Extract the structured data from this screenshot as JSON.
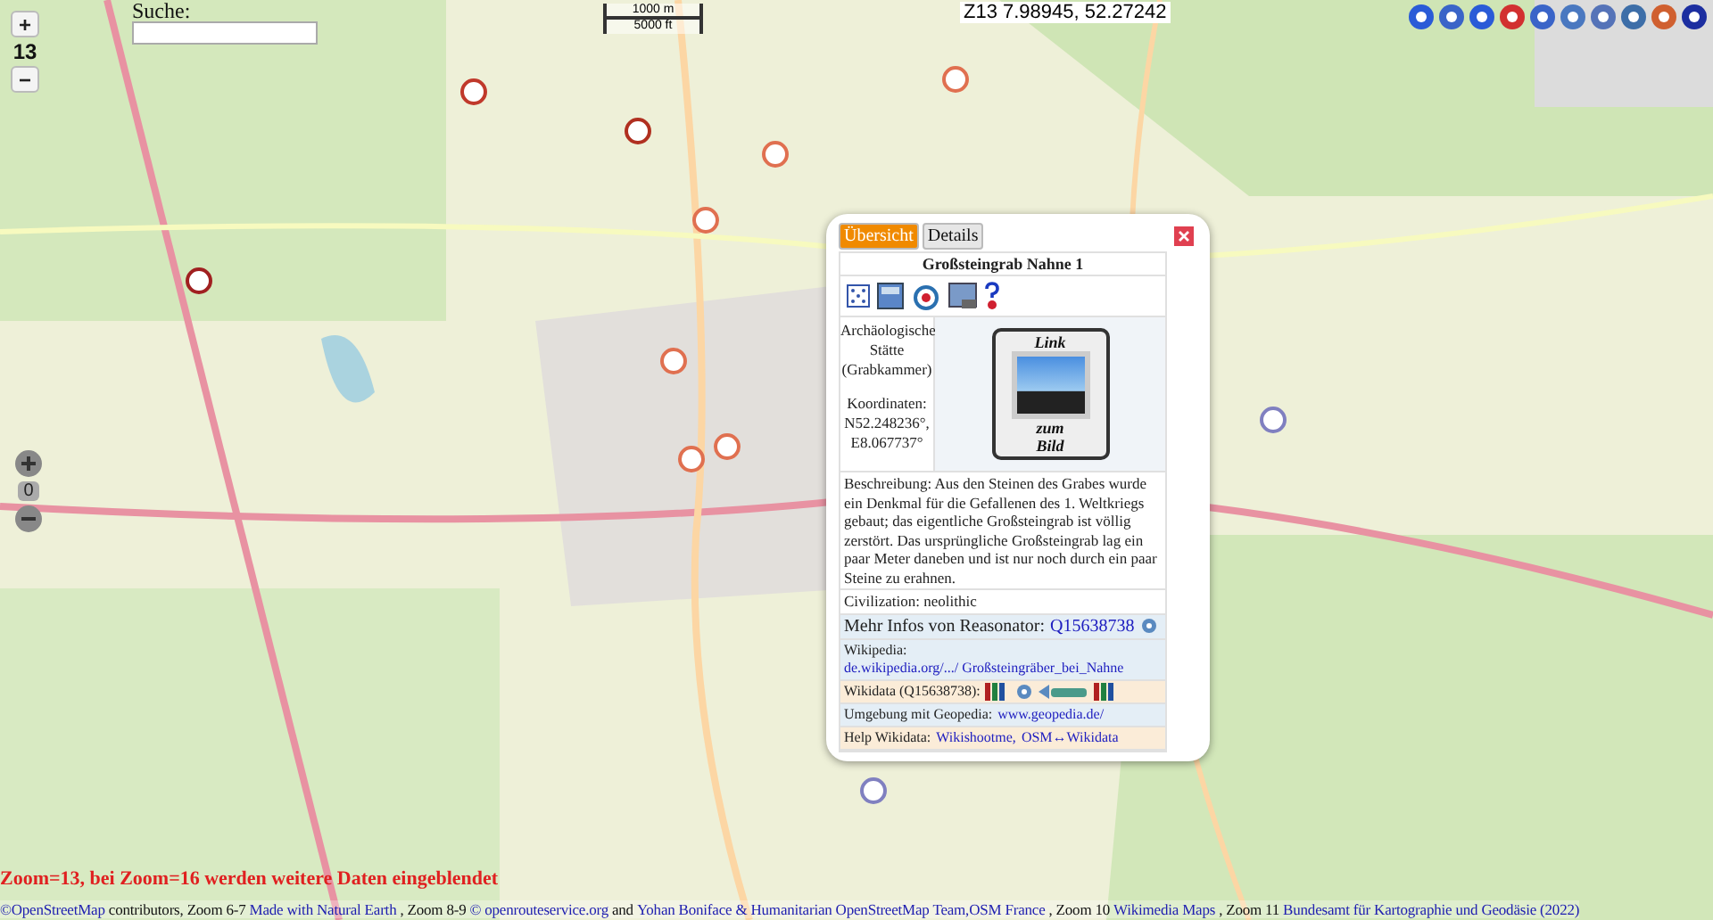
{
  "zoom_controls": {
    "plus": "+",
    "level": "13",
    "minus": "−"
  },
  "search": {
    "label": "Suche:"
  },
  "pan_controls": {
    "center": "0"
  },
  "scale": {
    "metric": "1000 m",
    "imperial": "5000 ft"
  },
  "coordinates": "Z13 7.98945, 52.27242",
  "popup": {
    "tabs": [
      {
        "label": "Übersicht",
        "selected": true
      },
      {
        "label": "Details",
        "selected": false
      }
    ],
    "title": "Großsteingrab Nahne 1",
    "category": "Archäologische Stätte (Grabkammer)",
    "coords": "Koordinaten: N52.248236°, E8.067737°",
    "image_link": {
      "top": "Link",
      "middle": "zum",
      "bottom": "Bild"
    },
    "description": "Beschreibung: Aus den Steinen des Grabes wurde ein Denkmal für die Gefallenen des 1. Weltkriegs gebaut; das eigentliche Großsteingrab ist völlig zerstört. Das ursprüngliche Großsteingrab lag ein paar Meter daneben und ist nur noch durch ein paar Steine zu erahnen.",
    "civilization": "Civilization: neolithic",
    "reasonator": {
      "label": "Mehr Infos von Reasonator:",
      "link": "Q15638738"
    },
    "wikipedia": {
      "label": "Wikipedia:",
      "link": "de.wikipedia.org/.../ Großsteingräber_bei_Nahne"
    },
    "wikidata": {
      "label": "Wikidata (Q15638738):"
    },
    "geopedia": {
      "label": "Umgebung mit Geopedia:",
      "link": "www.geopedia.de/"
    },
    "help": {
      "label": "Help Wikidata:",
      "links": [
        "Wikishootme,",
        "OSM↔Wikidata"
      ]
    }
  },
  "zoom_notice": "Zoom=13, bei Zoom=16 werden weitere Daten eingeblendet",
  "attribution": [
    {
      "kind": "link",
      "text": "©OpenStreetMap"
    },
    {
      "kind": "text",
      "text": "contributors, Zoom 6-7"
    },
    {
      "kind": "link",
      "text": "Made with Natural Earth"
    },
    {
      "kind": "text",
      "text": ", Zoom 8-9"
    },
    {
      "kind": "link",
      "text": "© openrouteservice.org"
    },
    {
      "kind": "text",
      "text": "and"
    },
    {
      "kind": "link",
      "text": "Yohan Boniface & Humanitarian OpenStreetMap Team,OSM France"
    },
    {
      "kind": "text",
      "text": ", Zoom 10"
    },
    {
      "kind": "link",
      "text": "Wikimedia Maps"
    },
    {
      "kind": "text",
      "text": ", Zoom 11"
    },
    {
      "kind": "link",
      "text": "Bundesamt für Kartographie und Geodäsie (2022)"
    }
  ]
}
